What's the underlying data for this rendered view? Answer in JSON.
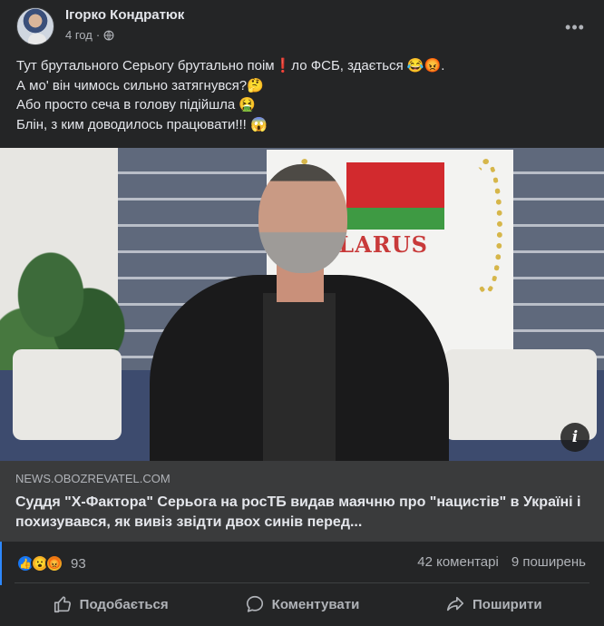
{
  "post": {
    "author": "Ігорко Кондратюк",
    "time": "4 год",
    "dot": "·",
    "more_icon": "ellipsis-icon",
    "text_lines": [
      "Тут брутального Серьогу брутально поім❗ло ФСБ, здається 😂😡.",
      "А мо' він чимось сильно затягнувся?🤔",
      "Або просто сеча в голову підійшла 🤮",
      "Блін, з ким доводилось працювати!!! 😱"
    ],
    "image": {
      "board_text": "ELARUS",
      "info_icon": "i"
    },
    "link": {
      "domain": "NEWS.OBOZREVATEL.COM",
      "title": "Суддя \"Х-Фактора\" Серьога на росТБ видав маячню про \"нацистів\" в Україні і похизувався, як вивіз звідти двох синів перед..."
    },
    "reactions": {
      "icons": [
        "👍",
        "😮",
        "😡"
      ],
      "count": "93",
      "comments": "42 коментарі",
      "shares": "9 поширень"
    },
    "actions": {
      "like": "Подобається",
      "comment": "Коментувати",
      "share": "Поширити"
    }
  },
  "colors": {
    "background": "#242526",
    "link_bg": "#3a3b3c",
    "text": "#e4e6eb",
    "secondary": "#b0b3b8",
    "accent": "#1877f2"
  }
}
